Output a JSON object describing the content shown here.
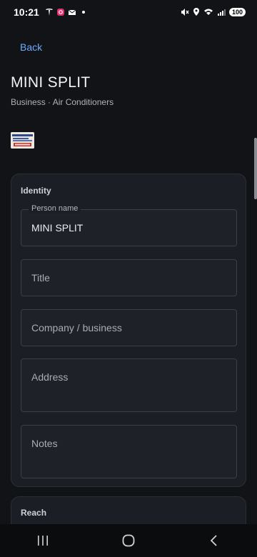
{
  "status_bar": {
    "time": "10:21",
    "battery": "100"
  },
  "header": {
    "back_label": "Back",
    "title": "MINI SPLIT",
    "subtitle": "Business · Air Conditioners"
  },
  "identity": {
    "section_title": "Identity",
    "person_name": {
      "label": "Person name",
      "value": "MINI SPLIT"
    },
    "title_field": {
      "placeholder": "Title"
    },
    "company_field": {
      "placeholder": "Company / business"
    },
    "address_field": {
      "placeholder": "Address"
    },
    "notes_field": {
      "placeholder": "Notes"
    }
  },
  "reach": {
    "section_title": "Reach"
  },
  "icons": {
    "nav_recents": "recents-icon",
    "nav_home": "home-icon",
    "nav_back": "back-icon"
  },
  "colors": {
    "background": "#121316",
    "card": "#1b1e24",
    "accent_link": "#6fa8ff"
  }
}
